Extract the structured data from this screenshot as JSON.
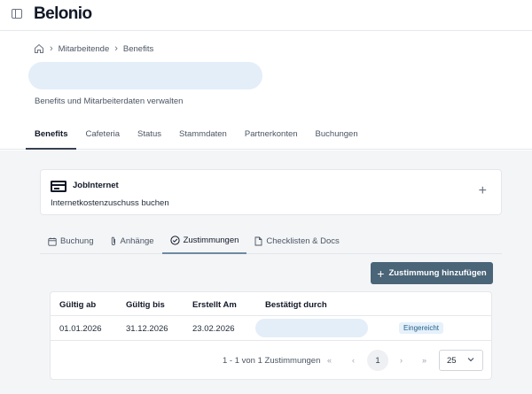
{
  "app": {
    "logo": "Belonio"
  },
  "breadcrumb": {
    "items": [
      "Mitarbeitende",
      "Benefits"
    ]
  },
  "header": {
    "subtitle": "Benefits und Mitarbeiterdaten verwalten"
  },
  "main_tabs": [
    "Benefits",
    "Cafeteria",
    "Status",
    "Stammdaten",
    "Partnerkonten",
    "Buchungen"
  ],
  "benefit_card": {
    "title": "JobInternet",
    "description": "Internetkostenzuschuss buchen",
    "add_symbol": "+"
  },
  "sub_tabs": [
    {
      "label": "Buchung",
      "icon": "calendar-icon"
    },
    {
      "label": "Anhänge",
      "icon": "paperclip-icon"
    },
    {
      "label": "Zustimmungen",
      "icon": "check-circle-icon"
    },
    {
      "label": "Checklisten & Docs",
      "icon": "document-icon"
    }
  ],
  "actions": {
    "add_consent": "Zustimmung hinzufügen"
  },
  "table": {
    "columns": [
      "Gültig ab",
      "Gültig bis",
      "Erstellt Am",
      "Bestätigt durch"
    ],
    "rows": [
      {
        "valid_from": "01.01.2026",
        "valid_to": "31.12.2026",
        "created": "23.02.2026",
        "status": "Eingereicht"
      }
    ]
  },
  "pagination": {
    "info": "1 - 1 von 1 Zustimmungen",
    "first": "«",
    "prev": "‹",
    "current": "1",
    "next": "›",
    "last": "»",
    "page_size": "25"
  },
  "colors": {
    "primary": "#4a6478",
    "placeholder": "#e3eef8",
    "background": "#f4f5f7",
    "badge_text": "#1f5f8b"
  }
}
